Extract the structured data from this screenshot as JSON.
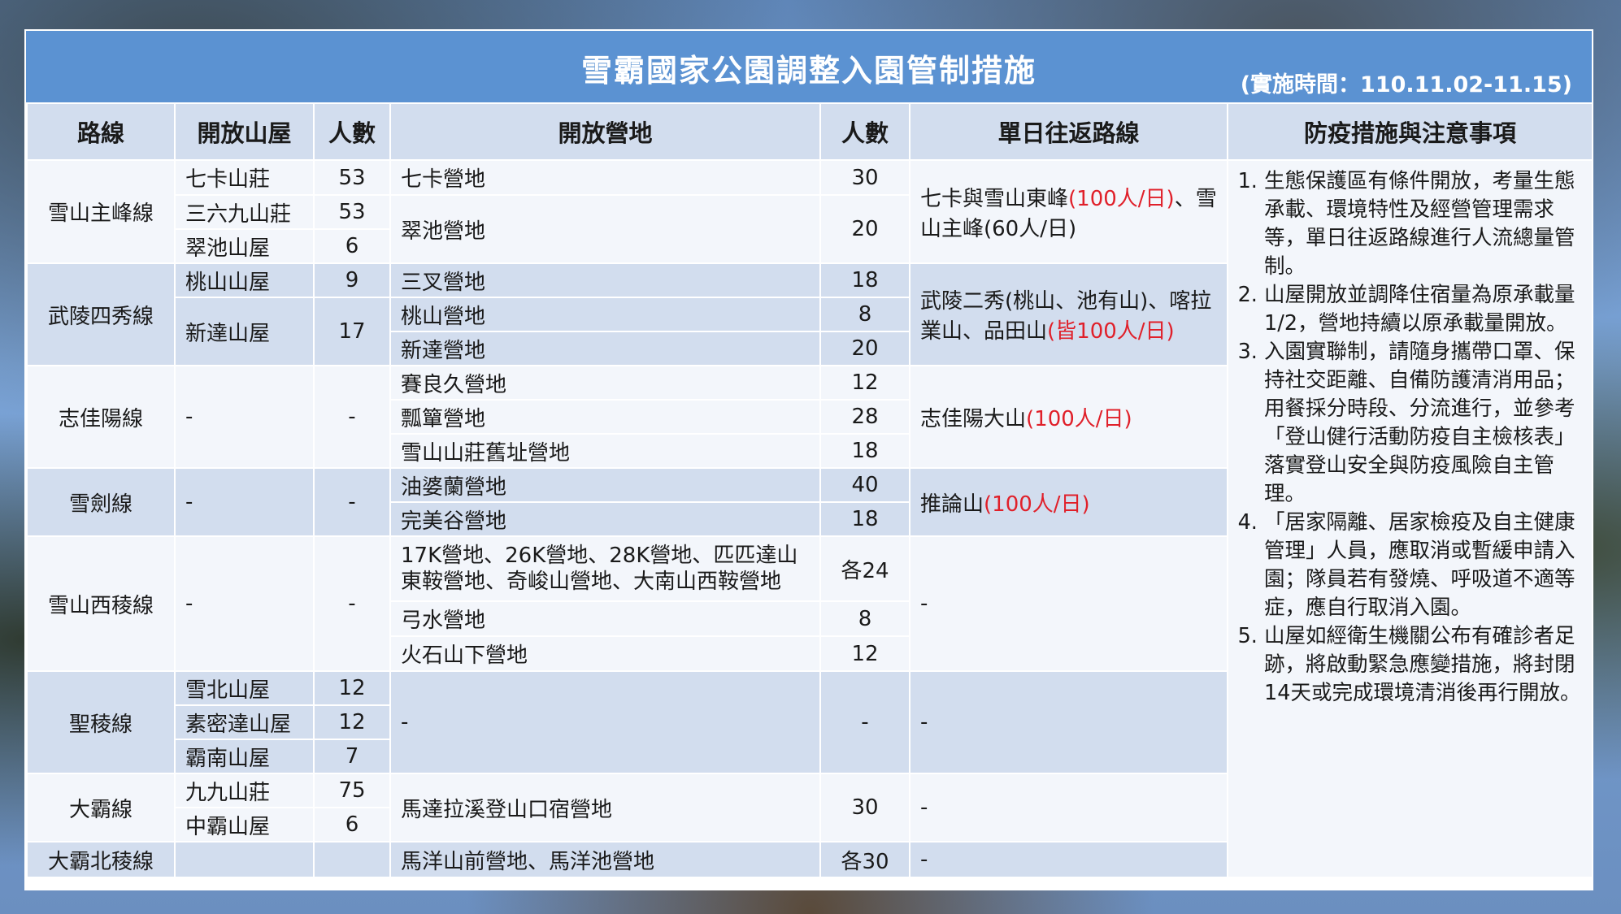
{
  "header": {
    "title": "雪霸國家公園調整入園管制措施",
    "period": "(實施時間：110.11.02-11.15)"
  },
  "columns": [
    "路線",
    "開放山屋",
    "人數",
    "開放營地",
    "人數",
    "單日往返路線",
    "防疫措施與注意事項"
  ],
  "routes": {
    "r1": {
      "name": "雪山主峰線",
      "cabins": [
        {
          "name": "七卡山莊",
          "count": "53"
        },
        {
          "name": "三六九山莊",
          "count": "53"
        },
        {
          "name": "翠池山屋",
          "count": "6"
        }
      ],
      "camps": [
        {
          "name": "七卡營地",
          "count": "30"
        },
        {
          "name": "翠池營地",
          "count": "20"
        }
      ],
      "day_prefix": "七卡與雪山東峰",
      "day_red": "(100人/日)",
      "day_suffix": "、雪山主峰(60人/日)"
    },
    "r2": {
      "name": "武陵四秀線",
      "cabins": [
        {
          "name": "桃山山屋",
          "count": "9"
        },
        {
          "name": "新達山屋",
          "count": "17"
        }
      ],
      "camps": [
        {
          "name": "三叉營地",
          "count": "18"
        },
        {
          "name": "桃山營地",
          "count": "8"
        },
        {
          "name": "新達營地",
          "count": "20"
        }
      ],
      "day_prefix": "武陵二秀(桃山、池有山)、喀拉業山、品田山",
      "day_red": "(皆100人/日)"
    },
    "r3": {
      "name": "志佳陽線",
      "cabin": "-",
      "count": "-",
      "camps": [
        {
          "name": "賽良久營地",
          "count": "12"
        },
        {
          "name": "瓢簞營地",
          "count": "28"
        },
        {
          "name": "雪山山莊舊址營地",
          "count": "18"
        }
      ],
      "day_prefix": "志佳陽大山",
      "day_red": "(100人/日)"
    },
    "r4": {
      "name": "雪劍線",
      "cabin": "-",
      "count": "-",
      "camps": [
        {
          "name": "油婆蘭營地",
          "count": "40"
        },
        {
          "name": "完美谷營地",
          "count": "18"
        }
      ],
      "day_prefix": "推論山",
      "day_red": "(100人/日)"
    },
    "r5": {
      "name": "雪山西稜線",
      "cabin": "-",
      "count": "-",
      "camps": [
        {
          "name": "17K營地、26K營地、28K營地、匹匹達山東鞍營地、奇峻山營地、大南山西鞍營地",
          "count": "各24"
        },
        {
          "name": "弓水營地",
          "count": "8"
        },
        {
          "name": "火石山下營地",
          "count": "12"
        }
      ],
      "day": "-"
    },
    "r6": {
      "name": "聖稜線",
      "cabins": [
        {
          "name": "雪北山屋",
          "count": "12"
        },
        {
          "name": "素密達山屋",
          "count": "12"
        },
        {
          "name": "霸南山屋",
          "count": "7"
        }
      ],
      "camp": "-",
      "camp_count": "-",
      "day": "-"
    },
    "r7": {
      "name": "大霸線",
      "cabins": [
        {
          "name": "九九山莊",
          "count": "75"
        },
        {
          "name": "中霸山屋",
          "count": "6"
        }
      ],
      "camp": "馬達拉溪登山口宿營地",
      "camp_count": "30",
      "day": "-"
    },
    "r8": {
      "name": "大霸北稜線",
      "camp": "馬洋山前營地、馬洋池營地",
      "camp_count": "各30",
      "day": "-"
    }
  },
  "notes": [
    "生態保護區有條件開放，考量生態承載、環境特性及經營管理需求等，單日往返路線進行人流總量管制。",
    "山屋開放並調降住宿量為原承載量1/2，營地持續以原承載量開放。",
    "入園實聯制，請隨身攜帶口罩、保持社交距離、自備防護清消用品；用餐採分時段、分流進行，並參考「登山健行活動防疫自主檢核表」落實登山安全與防疫風險自主管理。",
    "「居家隔離、居家檢疫及自主健康管理」人員，應取消或暫緩申請入園；隊員若有發燒、呼吸道不適等症，應自行取消入園。",
    "山屋如經衛生機關公布有確診者足跡，將啟動緊急應變措施，將封閉14天或完成環境清消後再行開放。"
  ]
}
